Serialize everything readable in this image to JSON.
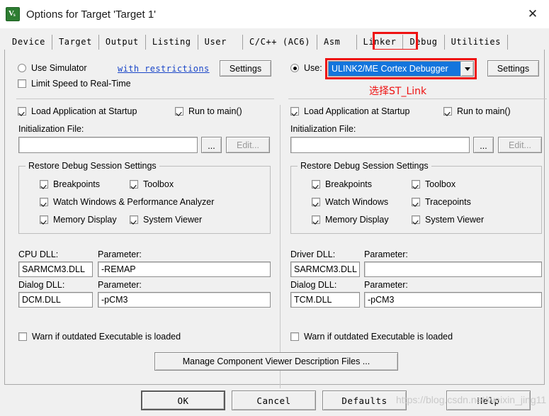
{
  "window": {
    "title": "Options for Target 'Target 1'",
    "icon": "uvision-icon",
    "close_label": "✕"
  },
  "tabs": [
    {
      "label": "Device",
      "active": false
    },
    {
      "label": "Target",
      "active": false
    },
    {
      "label": "Output",
      "active": false
    },
    {
      "label": "Listing",
      "active": false
    },
    {
      "label": "User",
      "active": false
    },
    {
      "label": "C/C++ (AC6)",
      "active": false
    },
    {
      "label": "Asm",
      "active": false
    },
    {
      "label": "Linker",
      "active": false
    },
    {
      "label": "Debug",
      "active": true
    },
    {
      "label": "Utilities",
      "active": false
    }
  ],
  "annotations": {
    "debug_tab_box_color": "#ee1111",
    "combo_box_color": "#ee1111",
    "select_stlink_text": "选择ST_Link",
    "watermark": "https://blog.csdn.net/weixin_jing11"
  },
  "left_panel": {
    "use_simulator": {
      "label": "Use Simulator",
      "checked": false
    },
    "with_restrictions_link": "with restrictions",
    "settings_button": "Settings",
    "limit_speed": {
      "label": "Limit Speed to Real-Time",
      "checked": false
    },
    "load_app_at_startup": {
      "label": "Load Application at Startup",
      "checked": true
    },
    "run_to_main": {
      "label": "Run to main()",
      "checked": true
    },
    "initialization_file_label": "Initialization File:",
    "initialization_file_value": "",
    "browse_button": "...",
    "edit_button": "Edit...",
    "restore_group_title": "Restore Debug Session Settings",
    "restore_items": [
      {
        "label": "Breakpoints",
        "checked": true
      },
      {
        "label": "Toolbox",
        "checked": true
      },
      {
        "label": "Watch Windows & Performance Analyzer",
        "checked": true
      },
      {
        "label": "Memory Display",
        "checked": true
      },
      {
        "label": "System Viewer",
        "checked": true
      }
    ],
    "cpu_dll_label": "CPU DLL:",
    "cpu_dll_value": "SARMCM3.DLL",
    "cpu_param_label": "Parameter:",
    "cpu_param_value": "-REMAP",
    "dialog_dll_label": "Dialog DLL:",
    "dialog_dll_value": "DCM.DLL",
    "dialog_param_label": "Parameter:",
    "dialog_param_value": "-pCM3",
    "warn_outdated": {
      "label": "Warn if outdated Executable is loaded",
      "checked": false
    }
  },
  "right_panel": {
    "use_radio": {
      "label": "Use:",
      "checked": true
    },
    "debugger_selected": "ULINK2/ME Cortex Debugger",
    "settings_button": "Settings",
    "load_app_at_startup": {
      "label": "Load Application at Startup",
      "checked": true
    },
    "run_to_main": {
      "label": "Run to main()",
      "checked": true
    },
    "initialization_file_label": "Initialization File:",
    "initialization_file_value": "",
    "browse_button": "...",
    "edit_button": "Edit...",
    "restore_group_title": "Restore Debug Session Settings",
    "restore_items": [
      {
        "label": "Breakpoints",
        "checked": true
      },
      {
        "label": "Toolbox",
        "checked": true
      },
      {
        "label": "Watch Windows",
        "checked": true
      },
      {
        "label": "Tracepoints",
        "checked": true
      },
      {
        "label": "Memory Display",
        "checked": true
      },
      {
        "label": "System Viewer",
        "checked": true
      }
    ],
    "driver_dll_label": "Driver DLL:",
    "driver_dll_value": "SARMCM3.DLL",
    "driver_param_label": "Parameter:",
    "driver_param_value": "",
    "dialog_dll_label": "Dialog DLL:",
    "dialog_dll_value": "TCM.DLL",
    "dialog_param_label": "Parameter:",
    "dialog_param_value": "-pCM3",
    "warn_outdated": {
      "label": "Warn if outdated Executable is loaded",
      "checked": false
    }
  },
  "manage_button": "Manage Component Viewer Description Files ...",
  "footer": {
    "ok": "OK",
    "cancel": "Cancel",
    "defaults": "Defaults",
    "help": "Help"
  }
}
